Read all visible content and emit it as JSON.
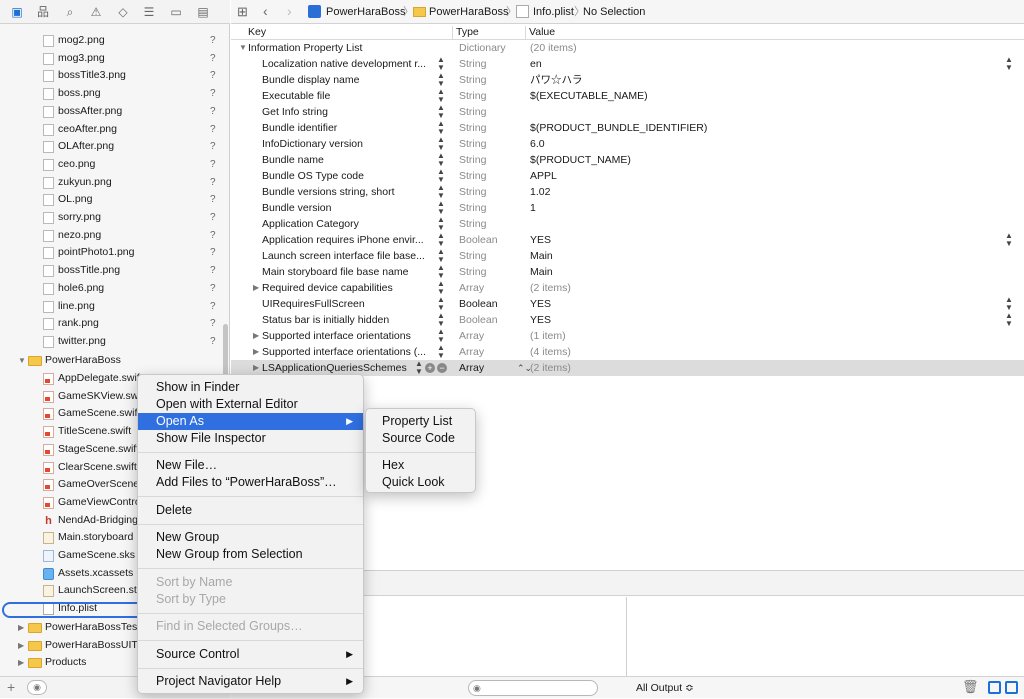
{
  "navigator": {
    "toolbar_icons": [
      "folder-icon",
      "hierarchy-icon",
      "search-icon",
      "warning-icon",
      "diamond-icon",
      "list-icon",
      "label-icon",
      "comment-icon"
    ],
    "files_top": [
      {
        "name": "mog2.png",
        "badge": "?"
      },
      {
        "name": "mog3.png",
        "badge": "?"
      },
      {
        "name": "bossTitle3.png",
        "badge": "?"
      },
      {
        "name": "boss.png",
        "badge": "?"
      },
      {
        "name": "bossAfter.png",
        "badge": "?"
      },
      {
        "name": "ceoAfter.png",
        "badge": "?"
      },
      {
        "name": "OLAfter.png",
        "badge": "?"
      },
      {
        "name": "ceo.png",
        "badge": "?"
      },
      {
        "name": "zukyun.png",
        "badge": "?"
      },
      {
        "name": "OL.png",
        "badge": "?"
      },
      {
        "name": "sorry.png",
        "badge": "?"
      },
      {
        "name": "nezo.png",
        "badge": "?"
      },
      {
        "name": "pointPhoto1.png",
        "badge": "?"
      },
      {
        "name": "bossTitle.png",
        "badge": "?"
      },
      {
        "name": "hole6.png",
        "badge": "?"
      },
      {
        "name": "line.png",
        "badge": "?"
      },
      {
        "name": "rank.png",
        "badge": "?"
      },
      {
        "name": "twitter.png",
        "badge": "?"
      }
    ],
    "group_main": "PowerHaraBoss",
    "group_files": [
      {
        "name": "AppDelegate.swift",
        "kind": "swift"
      },
      {
        "name": "GameSKView.swift",
        "kind": "swift"
      },
      {
        "name": "GameScene.swift",
        "kind": "swift"
      },
      {
        "name": "TitleScene.swift",
        "kind": "swift"
      },
      {
        "name": "StageScene.swift",
        "kind": "swift"
      },
      {
        "name": "ClearScene.swift",
        "kind": "swift"
      },
      {
        "name": "GameOverScene.swift",
        "kind": "swift"
      },
      {
        "name": "GameViewController.swift",
        "kind": "swift"
      },
      {
        "name": "NendAd-Bridging-Header.h",
        "kind": "header"
      },
      {
        "name": "Main.storyboard",
        "kind": "storyboard"
      },
      {
        "name": "GameScene.sks",
        "kind": "sks"
      },
      {
        "name": "Assets.xcassets",
        "kind": "assets"
      },
      {
        "name": "LaunchScreen.storyboard",
        "kind": "storyboard"
      },
      {
        "name": "Info.plist",
        "kind": "plist"
      }
    ],
    "groups_bottom": [
      "PowerHaraBossTests",
      "PowerHaraBossUITests",
      "Products"
    ]
  },
  "jumpbar": {
    "crumb1": "PowerHaraBoss",
    "crumb2": "PowerHaraBoss",
    "crumb3": "Info.plist",
    "crumb4": "No Selection"
  },
  "plist": {
    "headers": {
      "key": "Key",
      "type": "Type",
      "value": "Value"
    },
    "root": {
      "key": "Information Property List",
      "type": "Dictionary",
      "value": "(20 items)"
    },
    "rows": [
      {
        "key": "Localization native development r...",
        "type": "String",
        "value": "en"
      },
      {
        "key": "Bundle display name",
        "type": "String",
        "value": "パワ☆ハラ"
      },
      {
        "key": "Executable file",
        "type": "String",
        "value": "$(EXECUTABLE_NAME)"
      },
      {
        "key": "Get Info string",
        "type": "String",
        "value": ""
      },
      {
        "key": "Bundle identifier",
        "type": "String",
        "value": "$(PRODUCT_BUNDLE_IDENTIFIER)"
      },
      {
        "key": "InfoDictionary version",
        "type": "String",
        "value": "6.0"
      },
      {
        "key": "Bundle name",
        "type": "String",
        "value": "$(PRODUCT_NAME)"
      },
      {
        "key": "Bundle OS Type code",
        "type": "String",
        "value": "APPL"
      },
      {
        "key": "Bundle versions string, short",
        "type": "String",
        "value": "1.02"
      },
      {
        "key": "Bundle version",
        "type": "String",
        "value": "1"
      },
      {
        "key": "Application Category",
        "type": "String",
        "value": ""
      },
      {
        "key": "Application requires iPhone envir...",
        "type": "Boolean",
        "value": "YES"
      },
      {
        "key": "Launch screen interface file base...",
        "type": "String",
        "value": "Main"
      },
      {
        "key": "Main storyboard file base name",
        "type": "String",
        "value": "Main"
      },
      {
        "key": "Required device capabilities",
        "type": "Array",
        "value": "(2 items)"
      },
      {
        "key": "UIRequiresFullScreen",
        "type": "Boolean",
        "value": "YES"
      },
      {
        "key": "Status bar is initially hidden",
        "type": "Boolean",
        "value": "YES"
      },
      {
        "key": "Supported interface orientations",
        "type": "Array",
        "value": "(1 item)"
      },
      {
        "key": "Supported interface orientations (...",
        "type": "Array",
        "value": "(4 items)"
      },
      {
        "key": "LSApplicationQueriesSchemes",
        "type": "Array",
        "value": "(2 items)"
      }
    ]
  },
  "context_menu": {
    "show_in_finder": "Show in Finder",
    "open_external": "Open with External Editor",
    "open_as": "Open As",
    "show_inspector": "Show File Inspector",
    "new_file": "New File…",
    "add_files": "Add Files to “PowerHaraBoss”…",
    "delete": "Delete",
    "new_group": "New Group",
    "new_group_sel": "New Group from Selection",
    "sort_name": "Sort by Name",
    "sort_type": "Sort by Type",
    "find_groups": "Find in Selected Groups…",
    "source_control": "Source Control",
    "nav_help": "Project Navigator Help"
  },
  "submenu": {
    "property_list": "Property List",
    "source_code": "Source Code",
    "hex": "Hex",
    "quick_look": "Quick Look"
  },
  "bottom": {
    "all_output": "All Output ≎"
  }
}
